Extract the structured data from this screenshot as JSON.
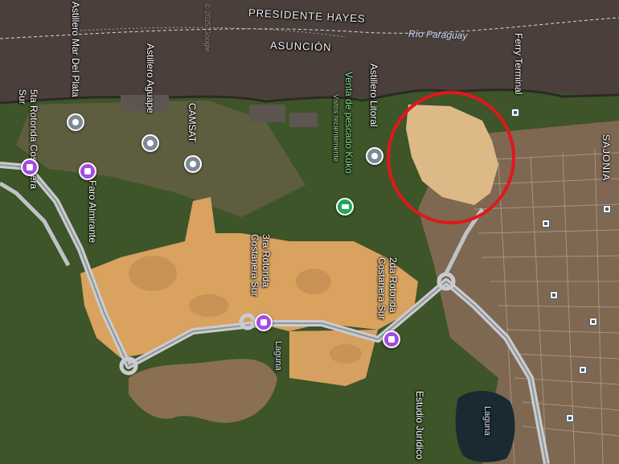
{
  "map": {
    "river": {
      "name": "Río Paraguay"
    },
    "regions": {
      "north": "PRESIDENTE HAYES",
      "south": "ASUNCIÓN"
    },
    "neighborhood": "SAJONIA",
    "watermark": "© 2025 Google",
    "places": {
      "astillero_mar_del_plata": "Astillero Mar Del Plata",
      "astillero_aguape": "Astillero Aguape",
      "camsat": "CAMSAT",
      "venta_pescado": "Venta de pescado Kuko",
      "venta_pescado_sub": "Vistos recientemente",
      "astillero_litoral": "Astillero Litoral",
      "ferry_terminal": "Ferry Terminal",
      "rotonda_5ta": "5ta Rotonda Costanera Sur",
      "faro_almirante": "Faro Almirante",
      "rotonda_3ra": "3ra Rotonda Costanera Sur",
      "rotonda_2da": "2da Rotonda Costanera Sur",
      "laguna_1": "Laguna",
      "laguna_2": "Laguna",
      "estudio": "Estudio Jurídico"
    },
    "highlight": {
      "color": "#e3161d",
      "shape": "circle"
    },
    "colors": {
      "river": "#4a3f3a",
      "sand": "#d9a25e",
      "vegetation": "#3c5a2a",
      "urban": "#8a6b55"
    }
  }
}
